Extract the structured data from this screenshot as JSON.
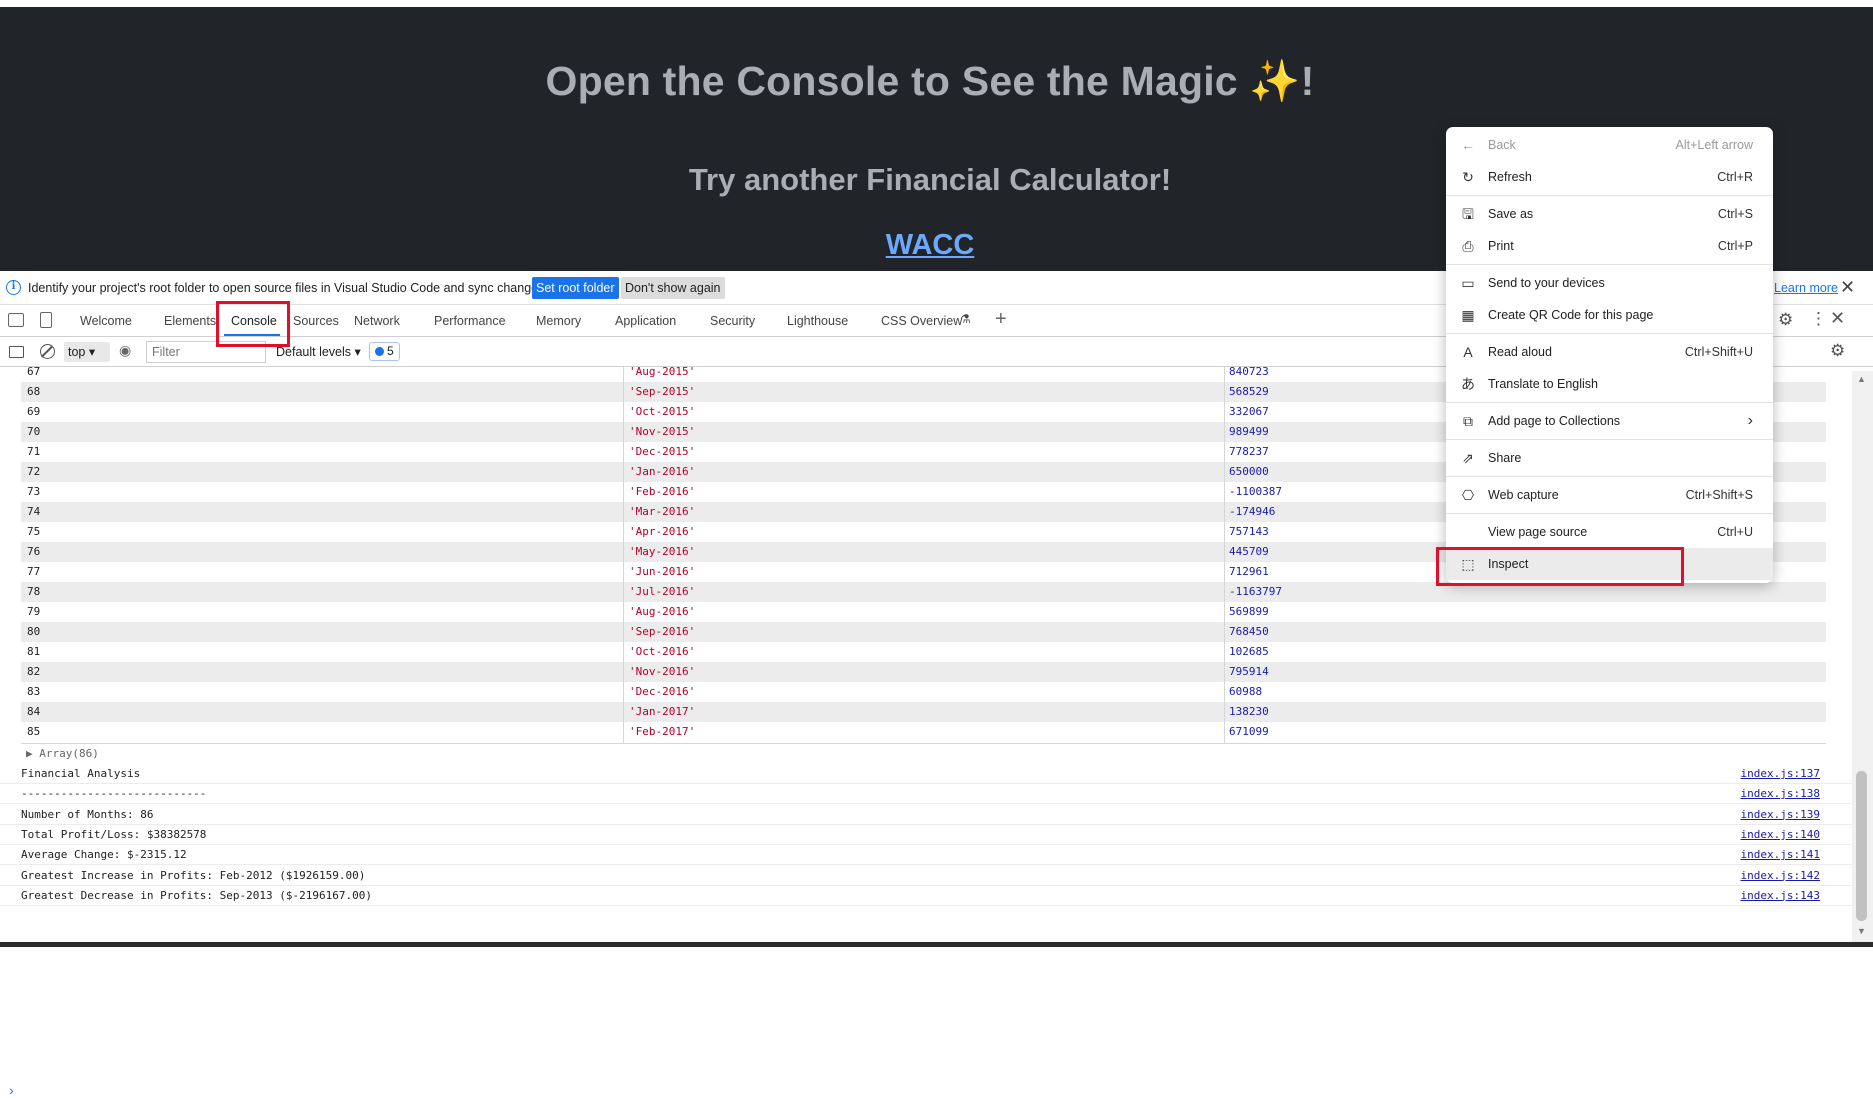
{
  "page": {
    "title": "Open the Console to See the Magic ✨!",
    "subtitle": "Try another Financial Calculator!",
    "link": "WACC"
  },
  "infobar": {
    "message": "Identify your project's root folder to open source files in Visual Studio Code and sync changes.",
    "set_root_label": "Set root folder",
    "dont_show_label": "Don't show again",
    "learn_more_label": "Learn more"
  },
  "tabs": {
    "items": [
      "Welcome",
      "Elements",
      "Console",
      "Sources",
      "Network",
      "Performance",
      "Memory",
      "Application",
      "Security",
      "Lighthouse",
      "CSS Overview"
    ],
    "active": "Console"
  },
  "filterbar": {
    "context": "top",
    "filter_placeholder": "Filter",
    "levels": "Default levels",
    "message_count": "5"
  },
  "table": {
    "rows": [
      [
        "67",
        "'Aug-2015'",
        "840723"
      ],
      [
        "68",
        "'Sep-2015'",
        "568529"
      ],
      [
        "69",
        "'Oct-2015'",
        "332067"
      ],
      [
        "70",
        "'Nov-2015'",
        "989499"
      ],
      [
        "71",
        "'Dec-2015'",
        "778237"
      ],
      [
        "72",
        "'Jan-2016'",
        "650000"
      ],
      [
        "73",
        "'Feb-2016'",
        "-1100387"
      ],
      [
        "74",
        "'Mar-2016'",
        "-174946"
      ],
      [
        "75",
        "'Apr-2016'",
        "757143"
      ],
      [
        "76",
        "'May-2016'",
        "445709"
      ],
      [
        "77",
        "'Jun-2016'",
        "712961"
      ],
      [
        "78",
        "'Jul-2016'",
        "-1163797"
      ],
      [
        "79",
        "'Aug-2016'",
        "569899"
      ],
      [
        "80",
        "'Sep-2016'",
        "768450"
      ],
      [
        "81",
        "'Oct-2016'",
        "102685"
      ],
      [
        "82",
        "'Nov-2016'",
        "795914"
      ],
      [
        "83",
        "'Dec-2016'",
        "60988"
      ],
      [
        "84",
        "'Jan-2017'",
        "138230"
      ],
      [
        "85",
        "'Feb-2017'",
        "671099"
      ]
    ]
  },
  "console": {
    "array_label": "▶ Array(86)",
    "logs": [
      {
        "text": "Financial Analysis",
        "source": "index.js:137"
      },
      {
        "text": "----------------------------",
        "source": "index.js:138"
      },
      {
        "text": "Number of Months: 86",
        "source": "index.js:139"
      },
      {
        "text": "Total Profit/Loss: $38382578",
        "source": "index.js:140"
      },
      {
        "text": "Average Change: $-2315.12",
        "source": "index.js:141"
      },
      {
        "text": "Greatest Increase in Profits: Feb-2012 ($1926159.00)",
        "source": "index.js:142"
      },
      {
        "text": "Greatest Decrease in Profits: Sep-2013 ($-2196167.00)",
        "source": "index.js:143"
      }
    ],
    "prompt": "›"
  },
  "context_menu": {
    "items": [
      {
        "label": "Back",
        "shortcut": "Alt+Left arrow",
        "icon": "back-arrow-icon",
        "glyph": "←",
        "disabled": true
      },
      {
        "label": "Refresh",
        "shortcut": "Ctrl+R",
        "icon": "refresh-icon",
        "glyph": "↻"
      },
      {
        "label": "Save as",
        "shortcut": "Ctrl+S",
        "icon": "save-icon",
        "glyph": "🖫"
      },
      {
        "label": "Print",
        "shortcut": "Ctrl+P",
        "icon": "print-icon",
        "glyph": "⎙"
      },
      {
        "label": "Send to your devices",
        "shortcut": "",
        "icon": "devices-icon",
        "glyph": "▭"
      },
      {
        "label": "Create QR Code for this page",
        "shortcut": "",
        "icon": "qr-code-icon",
        "glyph": "▦"
      },
      {
        "label": "Read aloud",
        "shortcut": "Ctrl+Shift+U",
        "icon": "read-aloud-icon",
        "glyph": "A"
      },
      {
        "label": "Translate to English",
        "shortcut": "",
        "icon": "translate-icon",
        "glyph": "あ"
      },
      {
        "label": "Add page to Collections",
        "shortcut": "›",
        "icon": "collections-icon",
        "glyph": "⧉"
      },
      {
        "label": "Share",
        "shortcut": "",
        "icon": "share-icon",
        "glyph": "⇗"
      },
      {
        "label": "Web capture",
        "shortcut": "Ctrl+Shift+S",
        "icon": "web-capture-icon",
        "glyph": "⎔"
      },
      {
        "label": "View page source",
        "shortcut": "Ctrl+U",
        "icon": "",
        "glyph": ""
      },
      {
        "label": "Inspect",
        "shortcut": "",
        "icon": "inspect-icon",
        "glyph": "⬚",
        "highlight": true
      }
    ]
  },
  "colors": {
    "page_bg": "#212529",
    "heading": "#a9aeb4",
    "link": "#6ea8fe",
    "accent": "#1a73e8",
    "highlight_box": "#e0102a",
    "string_value": "#b1002b",
    "number_value": "#1a1aa6"
  }
}
